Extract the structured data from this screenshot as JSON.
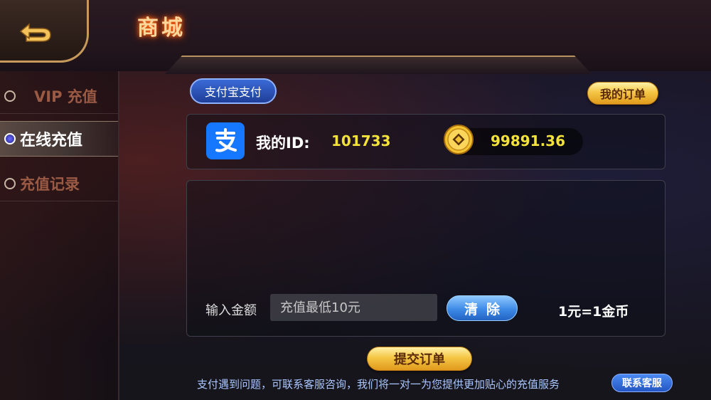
{
  "header": {
    "title": "商城"
  },
  "sidebar": {
    "items": [
      {
        "label": "VIP 充值",
        "active": false
      },
      {
        "label": "在线充值",
        "active": true
      },
      {
        "label": "充值记录",
        "active": false
      }
    ]
  },
  "payment": {
    "method_tab": "支付宝支付",
    "my_orders_label": "我的订单"
  },
  "account": {
    "id_label": "我的ID:",
    "id_value": "101733",
    "balance": "99891.36"
  },
  "recharge": {
    "amount_label": "输入金额",
    "amount_placeholder": "充值最低10元",
    "clear_label": "清除",
    "rate": "1元=1金币",
    "submit_label": "提交订单"
  },
  "footer": {
    "help_text": "支付遇到问题，可联系客服咨询，我们将一对一为您提供更加贴心的充值服务",
    "contact_label": "联系客服"
  },
  "colors": {
    "accent_gold": "#f5c645",
    "value_yellow": "#f3e23a",
    "alipay_blue": "#1677ff"
  },
  "icons": [
    "back-arrow-icon",
    "alipay-icon",
    "gold-coin-icon",
    "radio-dot-icon"
  ]
}
